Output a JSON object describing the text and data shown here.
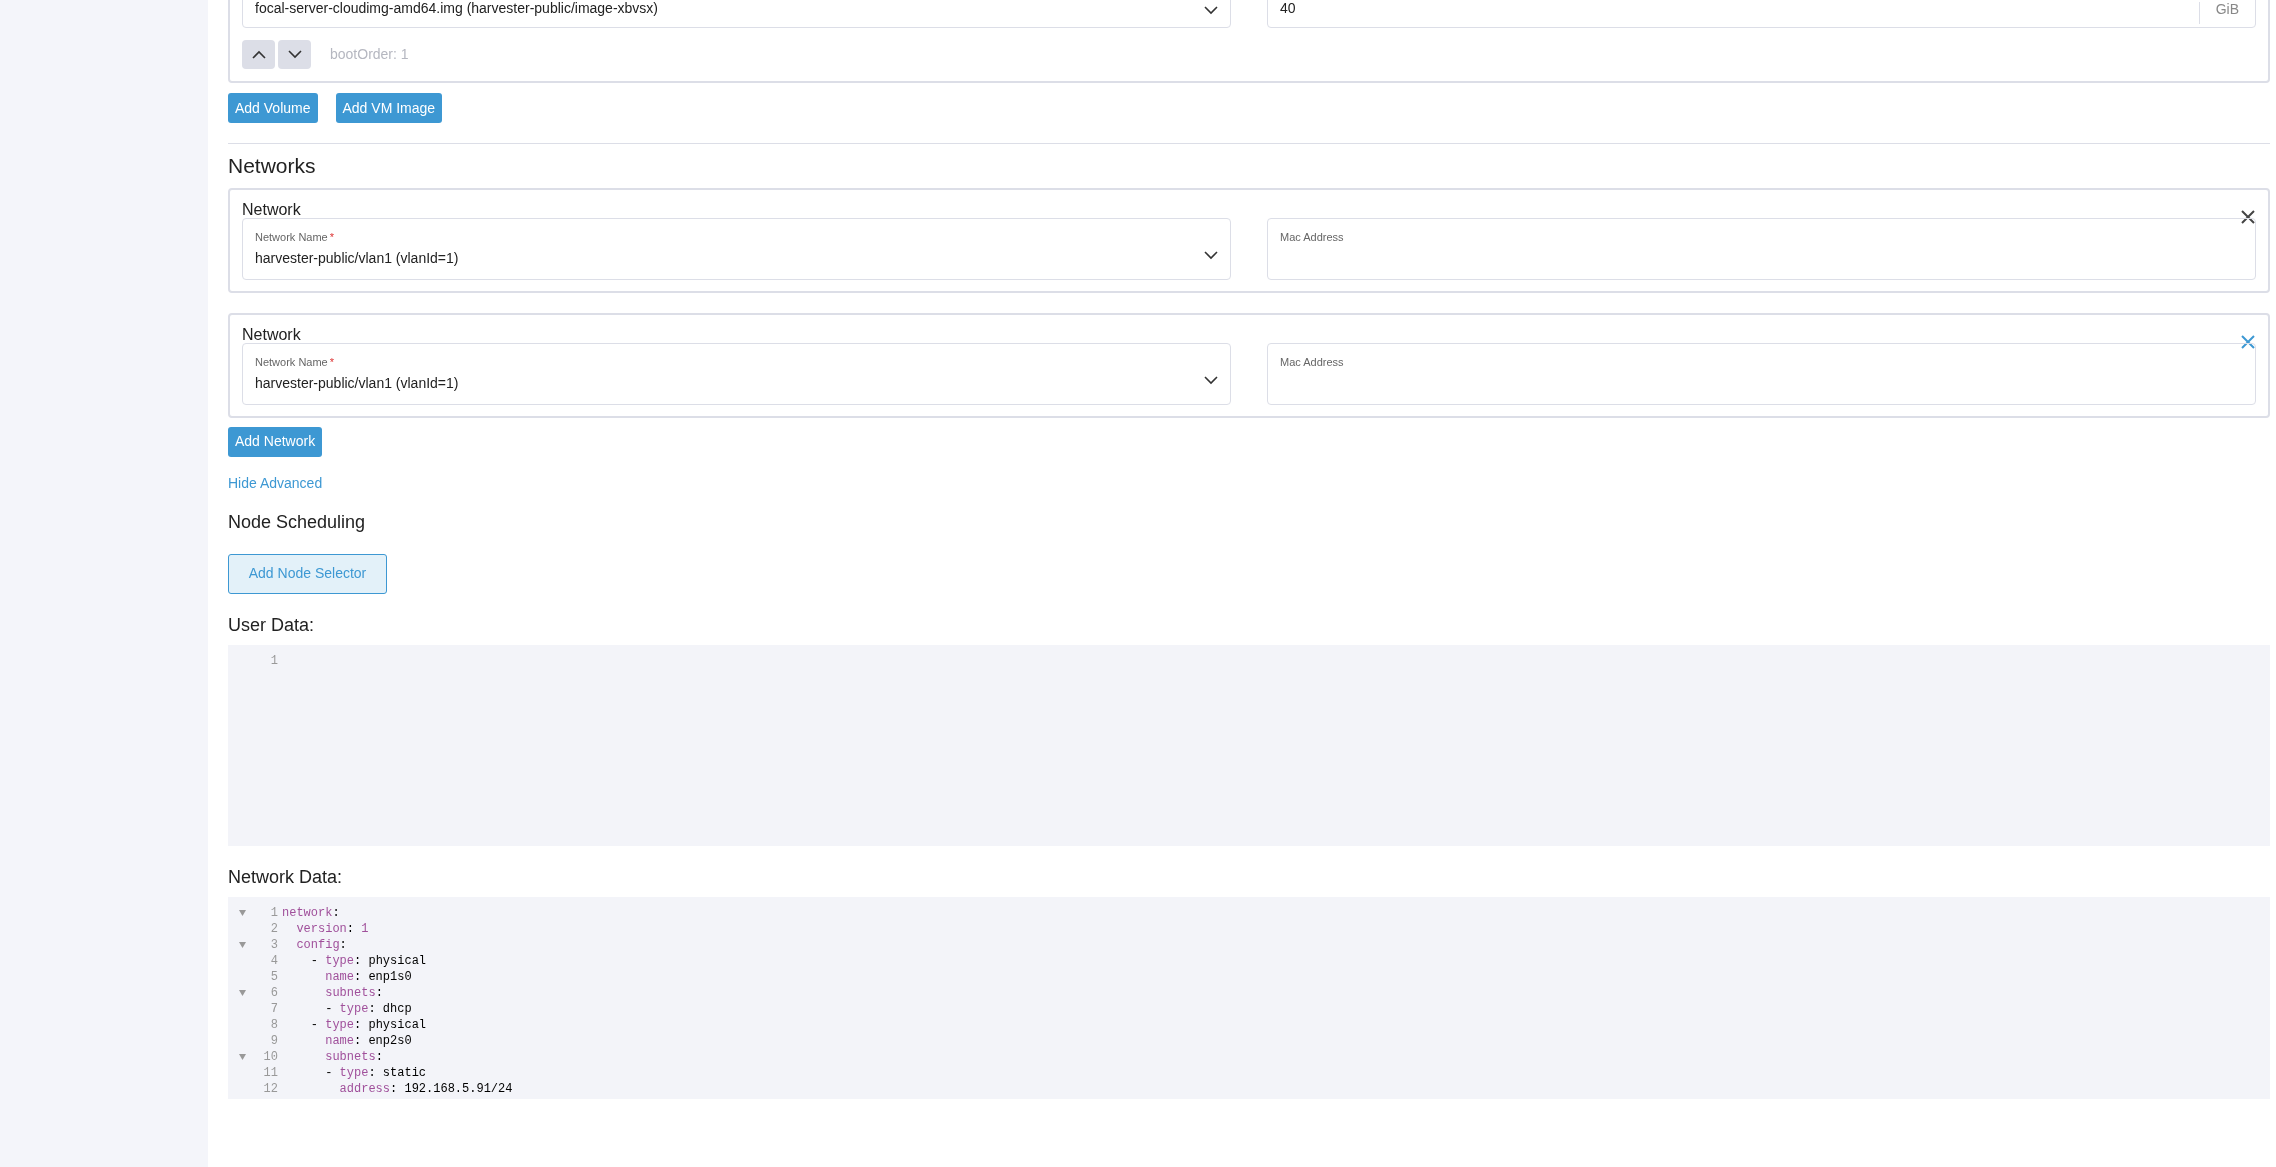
{
  "volume": {
    "image": "focal-server-cloudimg-amd64.img (harvester-public/image-xbvsx)",
    "size": "40",
    "unit": "GiB",
    "boot_order": "bootOrder: 1"
  },
  "volume_buttons": [
    "Add Volume",
    "Add VM Image"
  ],
  "networks": {
    "title": "Networks",
    "items": [
      {
        "title": "Network",
        "name_label": "Network Name",
        "required_mark": "*",
        "name_value": "harvester-public/vlan1 (vlanId=1)",
        "mac_label": "Mac Address",
        "close_hover": false
      },
      {
        "title": "Network",
        "name_label": "Network Name",
        "required_mark": "*",
        "name_value": "harvester-public/vlan1 (vlanId=1)",
        "mac_label": "Mac Address",
        "close_hover": true
      }
    ],
    "add_button": "Add Network"
  },
  "advanced_link": "Hide Advanced",
  "node_scheduling": {
    "title": "Node Scheduling",
    "button": "Add Node Selector"
  },
  "user_data": {
    "label": "User Data:",
    "lines": [
      {
        "number": "1",
        "foldable": false
      }
    ]
  },
  "network_data": {
    "label": "Network Data:",
    "lines": [
      {
        "number": "1",
        "foldable": true,
        "segments": [
          {
            "kind": "key",
            "text": "network"
          },
          {
            "kind": "plain",
            "text": ":"
          }
        ]
      },
      {
        "number": "2",
        "foldable": false,
        "segments": [
          {
            "kind": "key",
            "text": "  version"
          },
          {
            "kind": "plain",
            "text": ":"
          },
          {
            "kind": "number",
            "text": " 1"
          }
        ]
      },
      {
        "number": "3",
        "foldable": true,
        "segments": [
          {
            "kind": "key",
            "text": "  config"
          },
          {
            "kind": "plain",
            "text": ":"
          }
        ]
      },
      {
        "number": "4",
        "foldable": false,
        "segments": [
          {
            "kind": "plain",
            "text": "    - "
          },
          {
            "kind": "key",
            "text": "type"
          },
          {
            "kind": "plain",
            "text": ": physical"
          }
        ]
      },
      {
        "number": "5",
        "foldable": false,
        "segments": [
          {
            "kind": "key",
            "text": "      name"
          },
          {
            "kind": "plain",
            "text": ": enp1s0"
          }
        ]
      },
      {
        "number": "6",
        "foldable": true,
        "segments": [
          {
            "kind": "key",
            "text": "      subnets"
          },
          {
            "kind": "plain",
            "text": ":"
          }
        ]
      },
      {
        "number": "7",
        "foldable": false,
        "segments": [
          {
            "kind": "plain",
            "text": "      - "
          },
          {
            "kind": "key",
            "text": "type"
          },
          {
            "kind": "plain",
            "text": ": dhcp"
          }
        ]
      },
      {
        "number": "8",
        "foldable": false,
        "segments": [
          {
            "kind": "plain",
            "text": "    - "
          },
          {
            "kind": "key",
            "text": "type"
          },
          {
            "kind": "plain",
            "text": ": physical"
          }
        ]
      },
      {
        "number": "9",
        "foldable": false,
        "segments": [
          {
            "kind": "key",
            "text": "      name"
          },
          {
            "kind": "plain",
            "text": ": enp2s0"
          }
        ]
      },
      {
        "number": "10",
        "foldable": true,
        "segments": [
          {
            "kind": "key",
            "text": "      subnets"
          },
          {
            "kind": "plain",
            "text": ":"
          }
        ]
      },
      {
        "number": "11",
        "foldable": false,
        "segments": [
          {
            "kind": "plain",
            "text": "      - "
          },
          {
            "kind": "key",
            "text": "type"
          },
          {
            "kind": "plain",
            "text": ": static"
          }
        ]
      },
      {
        "number": "12",
        "foldable": false,
        "segments": [
          {
            "kind": "key",
            "text": "        address"
          },
          {
            "kind": "plain",
            "text": ": 192.168.5.91/24"
          }
        ]
      }
    ]
  }
}
